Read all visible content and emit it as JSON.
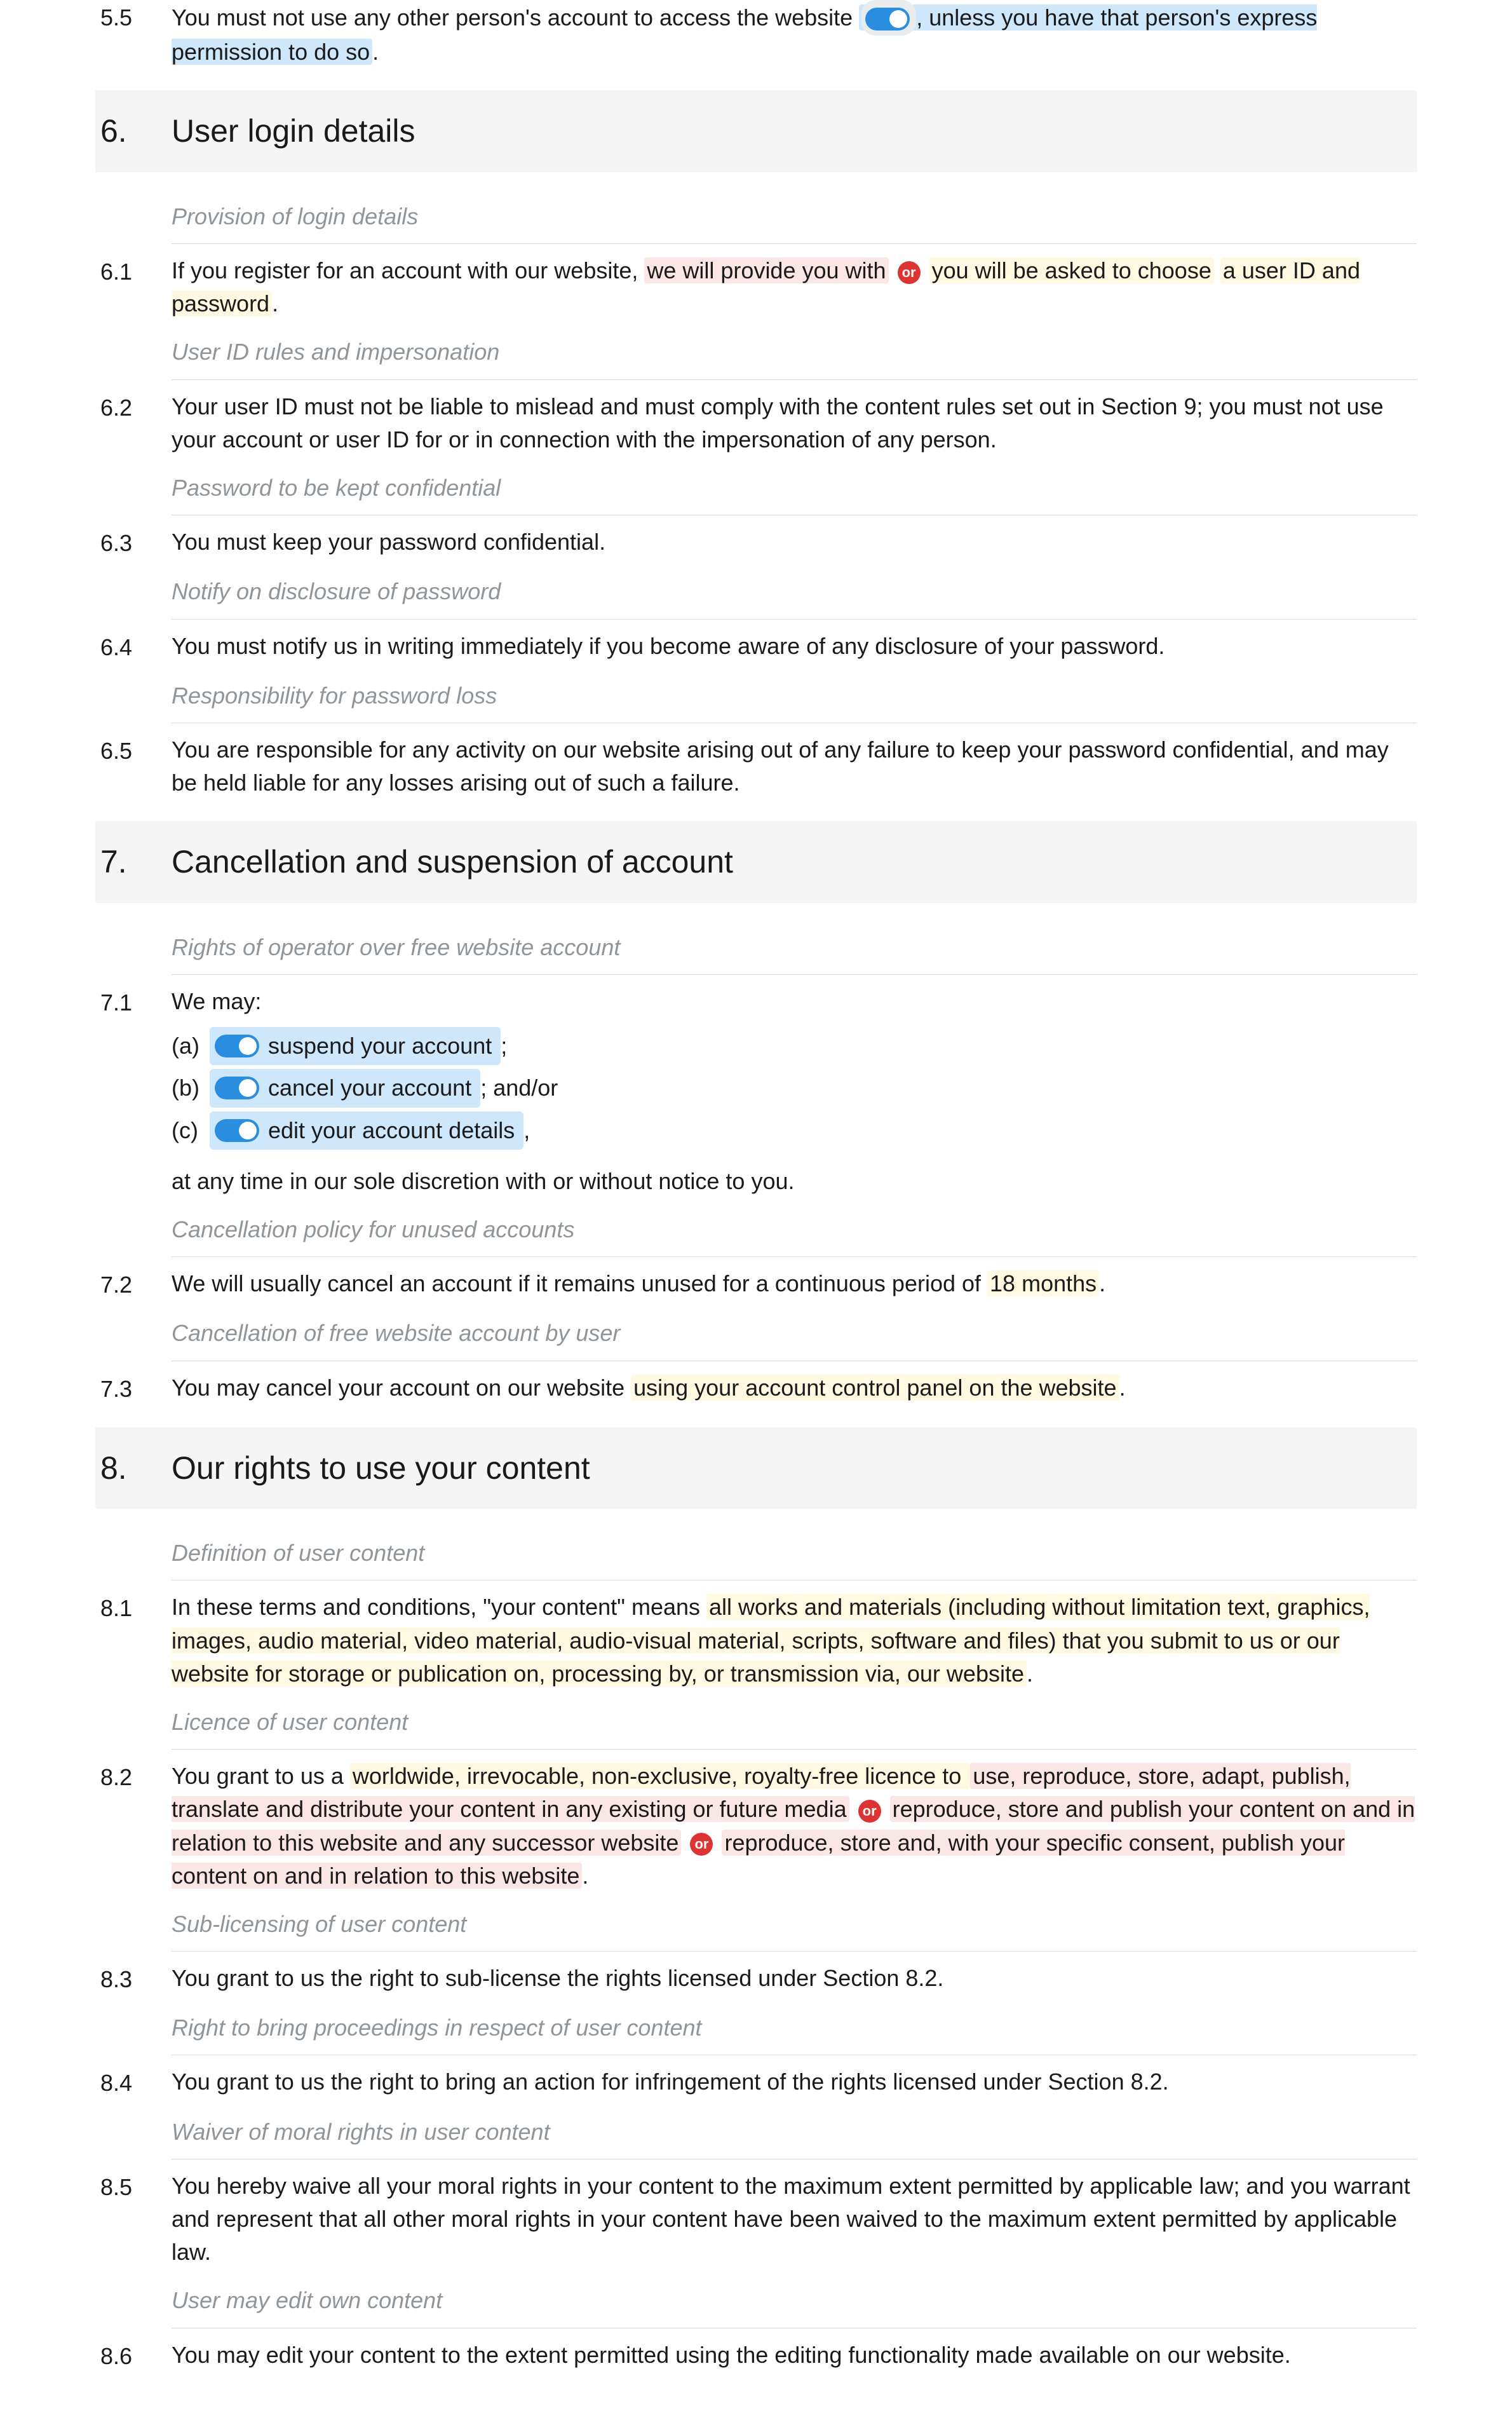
{
  "c5_5": {
    "num": "5.5",
    "pre": "You must not use any other person's account to access the website",
    "tail": ", unless you have that person's express permission to do so",
    "end": "."
  },
  "s6": {
    "num": "6.",
    "title": "User login details"
  },
  "n6_1": "Provision of login details",
  "c6_1": {
    "num": "6.1",
    "p1": "If you register for an account with our website,",
    "opt1": "we will provide you with",
    "opt2": "you will be asked to choose",
    "tail": "a user ID and password",
    "end": "."
  },
  "n6_2": "User ID rules and impersonation",
  "c6_2": {
    "num": "6.2",
    "text": "Your user ID must not be liable to mislead and must comply with the content rules set out in Section 9; you must not use your account or user ID for or in connection with the impersonation of any person."
  },
  "n6_3": "Password to be kept confidential",
  "c6_3": {
    "num": "6.3",
    "text": "You must keep your password confidential."
  },
  "n6_4": "Notify on disclosure of password",
  "c6_4": {
    "num": "6.4",
    "text": "You must notify us in writing immediately if you become aware of any disclosure of your password."
  },
  "n6_5": "Responsibility for password loss",
  "c6_5": {
    "num": "6.5",
    "text": "You are responsible for any activity on our website arising out of any failure to keep your password confidential, and may be held liable for any losses arising out of such a failure."
  },
  "s7": {
    "num": "7.",
    "title": "Cancellation and suspension of account"
  },
  "n7_1": "Rights of operator over free website account",
  "c7_1": {
    "num": "7.1",
    "lead": "We may:",
    "a_letter": "(a)",
    "a_text": "suspend your account",
    "a_tail": ";",
    "b_letter": "(b)",
    "b_text": "cancel your account",
    "b_tail": "; and/or",
    "c_letter": "(c)",
    "c_text": "edit your account details",
    "c_tail": ",",
    "trail": "at any time in our sole discretion with or without notice to you."
  },
  "n7_2": "Cancellation policy for unused accounts",
  "c7_2": {
    "num": "7.2",
    "pre": "We will usually cancel an account if it remains unused for a continuous period of ",
    "val": "18 months",
    "end": "."
  },
  "n7_3": "Cancellation of free website account by user",
  "c7_3": {
    "num": "7.3",
    "pre": "You may cancel your account on our website ",
    "val": "using your account control panel on the website",
    "end": "."
  },
  "s8": {
    "num": "8.",
    "title": "Our rights to use your content"
  },
  "n8_1": "Definition of user content",
  "c8_1": {
    "num": "8.1",
    "pre": "In these terms and conditions, \"your content\" means ",
    "val": "all works and materials (including without limitation text, graphics, images, audio material, video material, audio-visual material, scripts, software and files) that you submit to us or our website for storage or publication on, processing by, or transmission via, our website",
    "end": "."
  },
  "n8_2": "Licence of user content",
  "c8_2": {
    "num": "8.2",
    "pre": "You grant to us a ",
    "lic": "worldwide, irrevocable, non-exclusive, royalty-free licence to ",
    "opt1": "use, reproduce, store, adapt, publish, translate and distribute your content in any existing or future media",
    "opt2": "reproduce, store and publish your content on and in relation to this website and any successor website",
    "opt3": "reproduce, store and, with your specific consent, publish your content on and in relation to this website",
    "end": "."
  },
  "n8_3": "Sub-licensing of user content",
  "c8_3": {
    "num": "8.3",
    "text": "You grant to us the right to sub-license the rights licensed under Section 8.2."
  },
  "n8_4": "Right to bring proceedings in respect of user content",
  "c8_4": {
    "num": "8.4",
    "text": "You grant to us the right to bring an action for infringement of the rights licensed under Section 8.2."
  },
  "n8_5": "Waiver of moral rights in user content",
  "c8_5": {
    "num": "8.5",
    "text": "You hereby waive all your moral rights in your content to the maximum extent permitted by applicable law; and you warrant and represent that all other moral rights in your content have been waived to the maximum extent permitted by applicable law."
  },
  "n8_6": "User may edit own content",
  "c8_6": {
    "num": "8.6",
    "text": "You may edit your content to the extent permitted using the editing functionality made available on our website."
  },
  "or_label": "or"
}
